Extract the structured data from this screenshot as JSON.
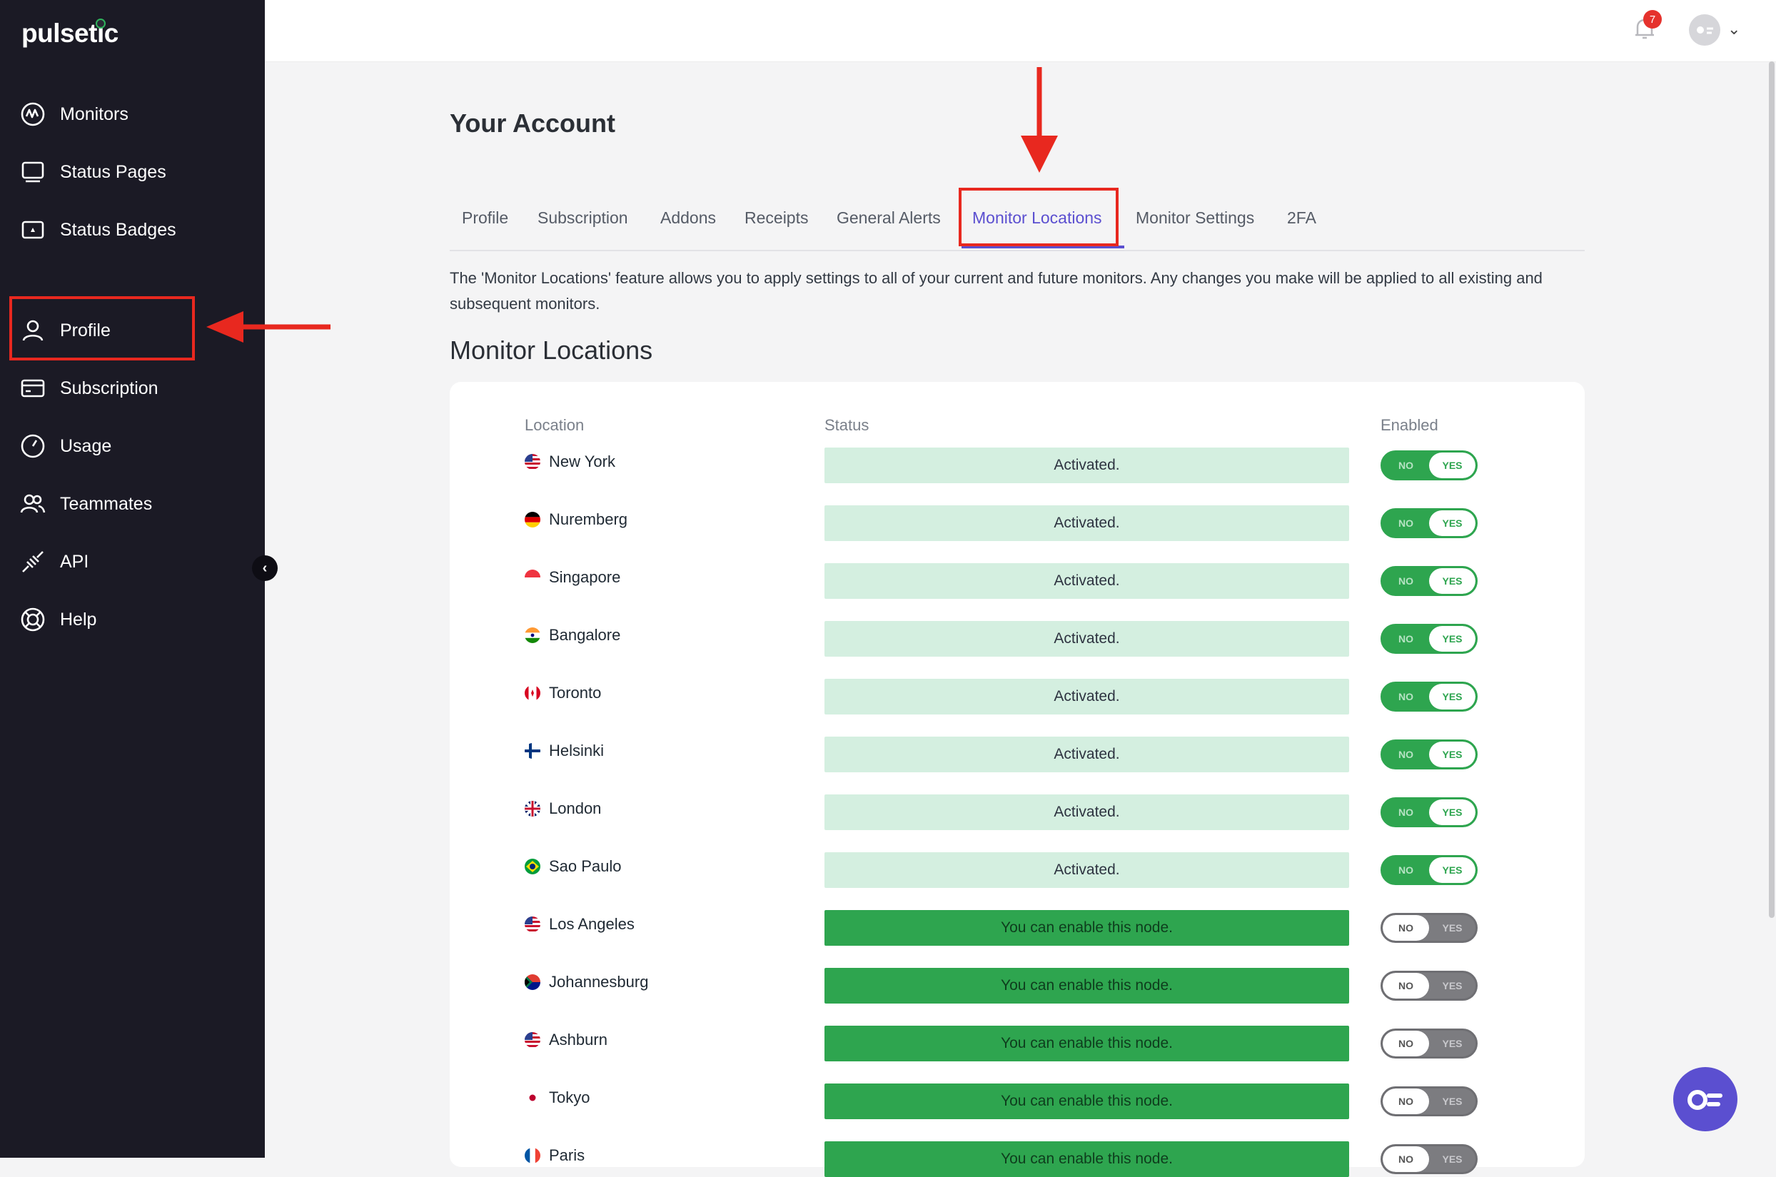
{
  "app": {
    "logo": "pulsetic"
  },
  "sidebar": {
    "items": [
      {
        "label": "Monitors",
        "icon": "monitor-pulse-icon"
      },
      {
        "label": "Status Pages",
        "icon": "screen-icon"
      },
      {
        "label": "Status Badges",
        "icon": "badge-icon"
      },
      {
        "label": "Profile",
        "icon": "user-icon"
      },
      {
        "label": "Subscription",
        "icon": "card-icon"
      },
      {
        "label": "Usage",
        "icon": "gauge-icon"
      },
      {
        "label": "Teammates",
        "icon": "users-icon"
      },
      {
        "label": "API",
        "icon": "plug-icon"
      },
      {
        "label": "Help",
        "icon": "lifebuoy-icon"
      }
    ],
    "collapse_glyph": "‹"
  },
  "topbar": {
    "notification_count": "7"
  },
  "page": {
    "title": "Your Account",
    "tabs": [
      "Profile",
      "Subscription",
      "Addons",
      "Receipts",
      "General Alerts",
      "Monitor Locations",
      "Monitor Settings",
      "2FA"
    ],
    "active_tab": "Monitor Locations",
    "description": "The 'Monitor Locations' feature allows you to apply settings to all of your current and future monitors. Any changes you make will be applied to all existing and subsequent monitors.",
    "section_title": "Monitor Locations"
  },
  "table": {
    "headers": {
      "location": "Location",
      "status": "Status",
      "enabled": "Enabled"
    },
    "toggle_labels": {
      "no": "NO",
      "yes": "YES"
    },
    "rows": [
      {
        "location": "New York",
        "status": "Activated.",
        "enabled": true,
        "flag": "us"
      },
      {
        "location": "Nuremberg",
        "status": "Activated.",
        "enabled": true,
        "flag": "de"
      },
      {
        "location": "Singapore",
        "status": "Activated.",
        "enabled": true,
        "flag": "sg"
      },
      {
        "location": "Bangalore",
        "status": "Activated.",
        "enabled": true,
        "flag": "in"
      },
      {
        "location": "Toronto",
        "status": "Activated.",
        "enabled": true,
        "flag": "ca"
      },
      {
        "location": "Helsinki",
        "status": "Activated.",
        "enabled": true,
        "flag": "fi"
      },
      {
        "location": "London",
        "status": "Activated.",
        "enabled": true,
        "flag": "gb"
      },
      {
        "location": "Sao Paulo",
        "status": "Activated.",
        "enabled": true,
        "flag": "br"
      },
      {
        "location": "Los Angeles",
        "status": "You can enable this node.",
        "enabled": false,
        "flag": "us"
      },
      {
        "location": "Johannesburg",
        "status": "You can enable this node.",
        "enabled": false,
        "flag": "za"
      },
      {
        "location": "Ashburn",
        "status": "You can enable this node.",
        "enabled": false,
        "flag": "us"
      },
      {
        "location": "Tokyo",
        "status": "You can enable this node.",
        "enabled": false,
        "flag": "jp"
      },
      {
        "location": "Paris",
        "status": "You can enable this node.",
        "enabled": false,
        "flag": "fr"
      }
    ]
  },
  "colors": {
    "accent": "#5b4fd0",
    "green": "#2ea54f",
    "highlight": "#e8281f",
    "sidebar": "#1b1a25"
  }
}
